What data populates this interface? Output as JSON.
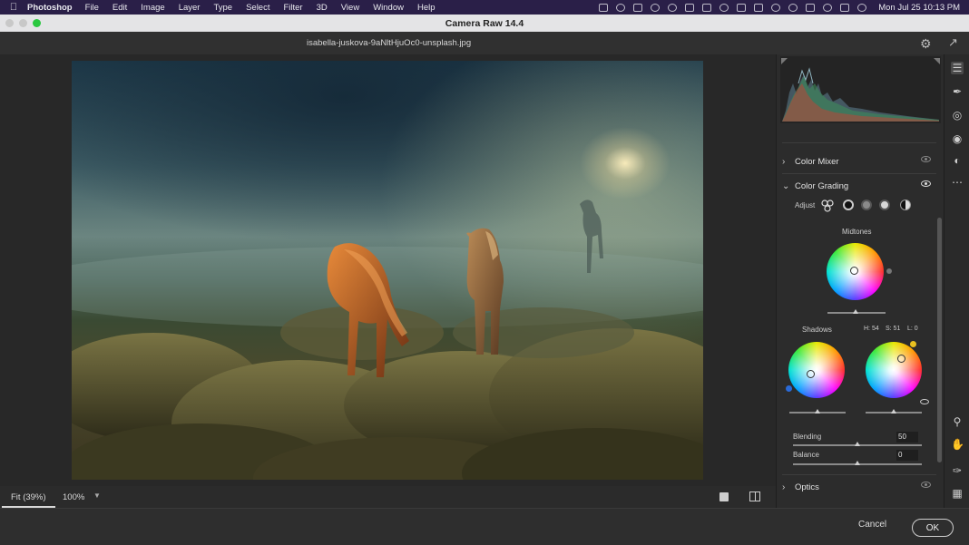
{
  "menubar": {
    "app_name": "Photoshop",
    "menus": [
      "File",
      "Edit",
      "Image",
      "Layer",
      "Type",
      "Select",
      "Filter",
      "3D",
      "View",
      "Window",
      "Help"
    ],
    "clock": "Mon Jul 25  10:13 PM"
  },
  "window": {
    "title": "Camera Raw 14.4"
  },
  "file": {
    "name": "isabella-juskova-9aNltHjuOc0-unsplash.jpg"
  },
  "status": {
    "fit_label": "Fit (39%)",
    "zoom_value": "100%"
  },
  "footer": {
    "cancel_label": "Cancel",
    "ok_label": "OK"
  },
  "panel": {
    "color_mixer_label": "Color Mixer",
    "color_grading_label": "Color Grading",
    "adjust_label": "Adjust",
    "midtones_label": "Midtones",
    "shadows_label": "Shadows",
    "hsl": {
      "h": "H: 54",
      "s": "S: 51",
      "l": "L: 0"
    },
    "blending_label": "Blending",
    "blending_value": "50",
    "balance_label": "Balance",
    "balance_value": "0",
    "optics_label": "Optics"
  },
  "colors": {
    "accent": "#e8c020",
    "panel_bg": "#2c2c2c",
    "menubar_bg": "#2a1f48"
  }
}
